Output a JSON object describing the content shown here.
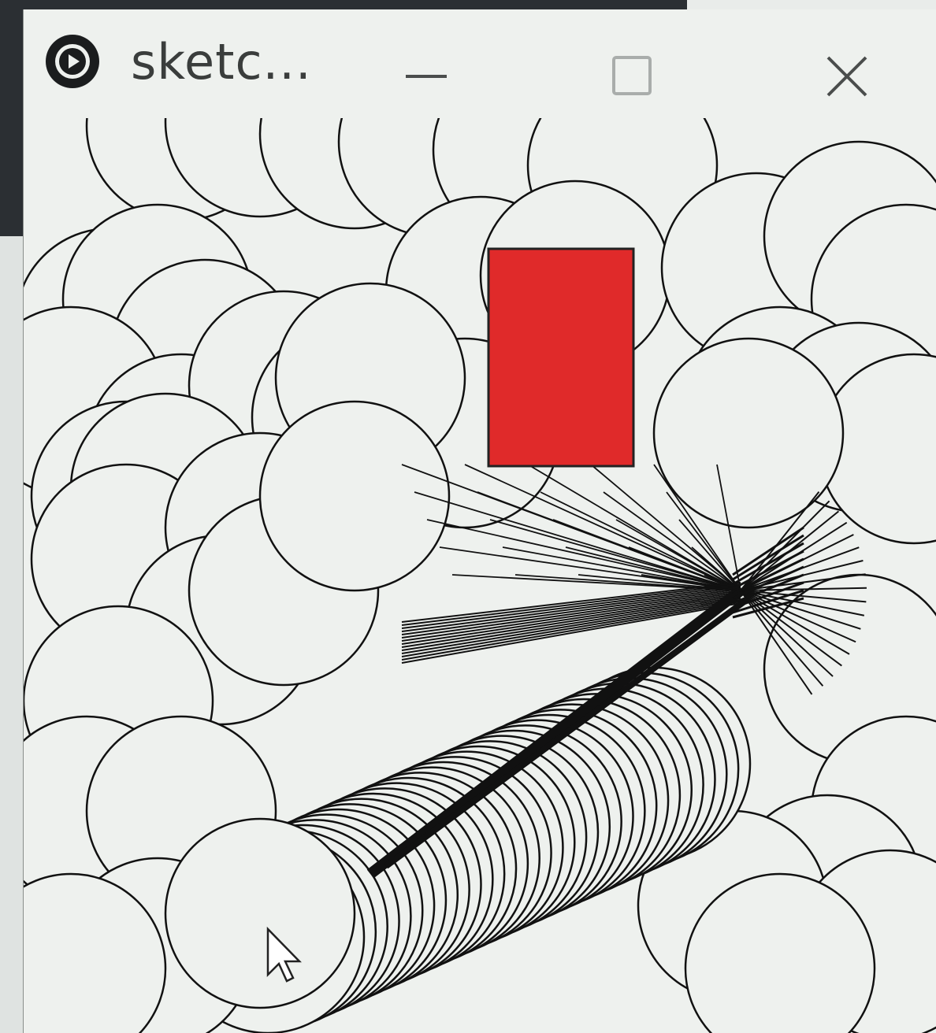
{
  "window": {
    "title": "sketc...",
    "app_icon": "play-circle-icon",
    "controls": [
      "minimize-icon",
      "maximize-icon",
      "close-icon"
    ]
  },
  "sketch": {
    "background_color": "#eef1ee",
    "stroke_color": "#111111",
    "rectangle_color": "#e02a2a",
    "cursor_icon": "arrow-cursor-icon"
  }
}
